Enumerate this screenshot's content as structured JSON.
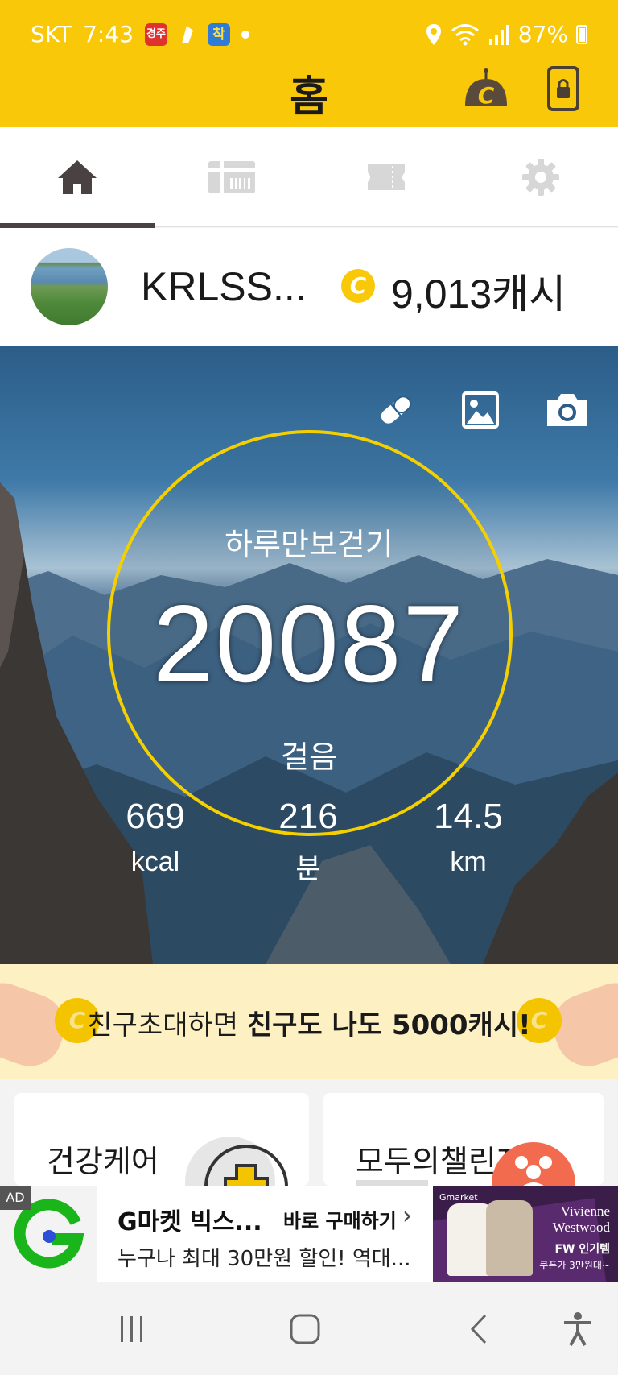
{
  "status_bar": {
    "carrier": "SKT",
    "time": "7:43",
    "badge_news": "경주",
    "badge_app": "착",
    "battery": "87%"
  },
  "header": {
    "title": "홈"
  },
  "tabs": [
    {
      "name": "home",
      "icon": "home-icon",
      "active": true
    },
    {
      "name": "gift-card",
      "icon": "gift-card-icon",
      "active": false
    },
    {
      "name": "ticket",
      "icon": "ticket-icon",
      "active": false
    },
    {
      "name": "settings",
      "icon": "gear-icon",
      "active": false
    }
  ],
  "profile": {
    "username": "KRLSS...",
    "coin_symbol": "C",
    "cash": "9,013캐시"
  },
  "hero": {
    "ring_title": "하루만보걷기",
    "steps": "20087",
    "steps_unit": "걸음",
    "stats": [
      {
        "value": "669",
        "unit": "kcal"
      },
      {
        "value": "216",
        "unit": "분"
      },
      {
        "value": "14.5",
        "unit": "km"
      }
    ]
  },
  "invite": {
    "text_normal": "친구초대하면 ",
    "text_bold": "친구도 나도 5000캐시!",
    "coin_symbol": "C"
  },
  "cards": {
    "left_title": "건강케어",
    "right_title": "모두의챌린지"
  },
  "ad": {
    "tag": "AD",
    "title": "G마켓 빅스...",
    "cta": "바로 구매하기",
    "description": "누구나 최대 30만원 할인! 역대...",
    "image": {
      "brand": "Gmarket",
      "line1": "Vivienne",
      "line2": "Westwood",
      "line3": "FW 인기템",
      "line4": "쿠폰가 3만원대~"
    }
  },
  "colors": {
    "brand_yellow": "#f9c909",
    "ring_yellow": "#f5d000",
    "invite_bg": "#fdf1c4"
  }
}
